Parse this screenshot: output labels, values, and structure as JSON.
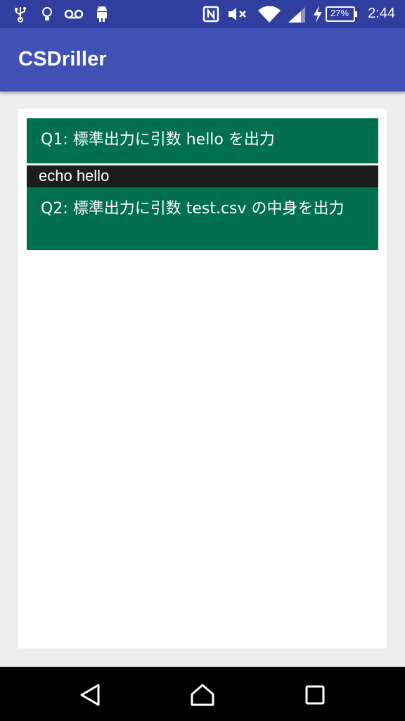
{
  "status_bar": {
    "time": "2:44",
    "battery_percent": "27%",
    "icons": [
      "usb-icon",
      "lightbulb-icon",
      "voicemail-icon",
      "android-icon",
      "nfc-icon",
      "mute-icon",
      "wifi-icon",
      "signal-icon",
      "charging-icon",
      "battery-icon"
    ]
  },
  "app_bar": {
    "title": "CSDriller"
  },
  "questions": [
    {
      "label": "Q1: 標準出力に引数 hello を出力",
      "answer": "echo hello"
    },
    {
      "label": "Q2: 標準出力に引数 test.csv の中身を出力"
    }
  ],
  "nav_bar": {
    "icons": [
      "back-icon",
      "home-icon",
      "recents-icon"
    ]
  },
  "colors": {
    "status_bar": "#303f9f",
    "app_bar": "#3f51b5",
    "question_bg": "#00704f",
    "answer_bg": "#1c1c1c",
    "background": "#eeeeee"
  }
}
